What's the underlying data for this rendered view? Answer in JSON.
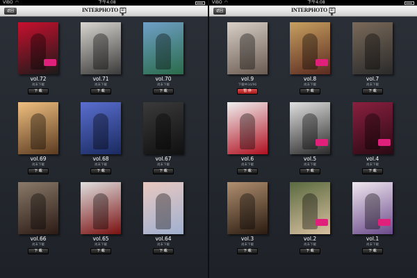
{
  "left": {
    "status": {
      "carrier": "VIBO",
      "time": "下午4:08"
    },
    "nav": {
      "back_label": "返回",
      "logo": "INTERPHOTO",
      "badge": "印象"
    },
    "items": [
      {
        "vol": "vol.72",
        "status": "尚未下載",
        "button": "下 載",
        "color_a": "#c8102e",
        "color_b": "#1a1a1a",
        "pink": true
      },
      {
        "vol": "vol.71",
        "status": "尚未下載",
        "button": "下 載",
        "color_a": "#d9d6d0",
        "color_b": "#3a3a3a",
        "pink": false
      },
      {
        "vol": "vol.70",
        "status": "尚未下載",
        "button": "下 載",
        "color_a": "#6fa0c8",
        "color_b": "#2a6b4a",
        "pink": false
      },
      {
        "vol": "vol.69",
        "status": "尚未下載",
        "button": "下 載",
        "color_a": "#f0c080",
        "color_b": "#5a3a20",
        "pink": false
      },
      {
        "vol": "vol.68",
        "status": "尚未下載",
        "button": "下 載",
        "color_a": "#5a6fd0",
        "color_b": "#1a2a60",
        "pink": false
      },
      {
        "vol": "vol.67",
        "status": "尚未下載",
        "button": "下 載",
        "color_a": "#3a3a3a",
        "color_b": "#101010",
        "pink": false
      },
      {
        "vol": "vol.66",
        "status": "尚未下載",
        "button": "下 載",
        "color_a": "#8a7a6a",
        "color_b": "#2a1a14",
        "pink": false
      },
      {
        "vol": "vol.65",
        "status": "尚未下載",
        "button": "下 載",
        "color_a": "#e0e0e0",
        "color_b": "#7a1010",
        "pink": false
      },
      {
        "vol": "vol.64",
        "status": "尚未下載",
        "button": "下 載",
        "color_a": "#e8c8c0",
        "color_b": "#a0b0d0",
        "pink": false
      }
    ]
  },
  "right": {
    "status": {
      "carrier": "VIBO",
      "time": "下午4:08"
    },
    "nav": {
      "back_label": "返回",
      "logo": "INTERPHOTO",
      "badge": "印象"
    },
    "items": [
      {
        "vol": "vol.9",
        "status": "下載中34/96",
        "button": "暫 停",
        "color_a": "#d8d0c8",
        "color_b": "#6a5a50",
        "pink": false,
        "pause": true
      },
      {
        "vol": "vol.8",
        "status": "尚未下載",
        "button": "下 載",
        "color_a": "#c8a060",
        "color_b": "#5a2a20",
        "pink": true
      },
      {
        "vol": "vol.7",
        "status": "尚未下載",
        "button": "下 載",
        "color_a": "#7a6a5a",
        "color_b": "#2a2a2a",
        "pink": false
      },
      {
        "vol": "vol.6",
        "status": "尚未下載",
        "button": "下 載",
        "color_a": "#f0f0f0",
        "color_b": "#b01020",
        "pink": false
      },
      {
        "vol": "vol.5",
        "status": "尚未下載",
        "button": "下 載",
        "color_a": "#e0e0e0",
        "color_b": "#2a2a2a",
        "pink": true
      },
      {
        "vol": "vol.4",
        "status": "尚未下載",
        "button": "下 載",
        "color_a": "#8a2040",
        "color_b": "#2a0a14",
        "pink": true
      },
      {
        "vol": "vol.3",
        "status": "尚未下載",
        "button": "下 載",
        "color_a": "#b09070",
        "color_b": "#2a1a10",
        "pink": false
      },
      {
        "vol": "vol.2",
        "status": "尚未下載",
        "button": "下 載",
        "color_a": "#5a6a40",
        "color_b": "#d8c0a0",
        "pink": true
      },
      {
        "vol": "vol.1",
        "status": "尚未下載",
        "button": "下 載",
        "color_a": "#f0e8f0",
        "color_b": "#6a4a8a",
        "pink": true
      }
    ]
  }
}
